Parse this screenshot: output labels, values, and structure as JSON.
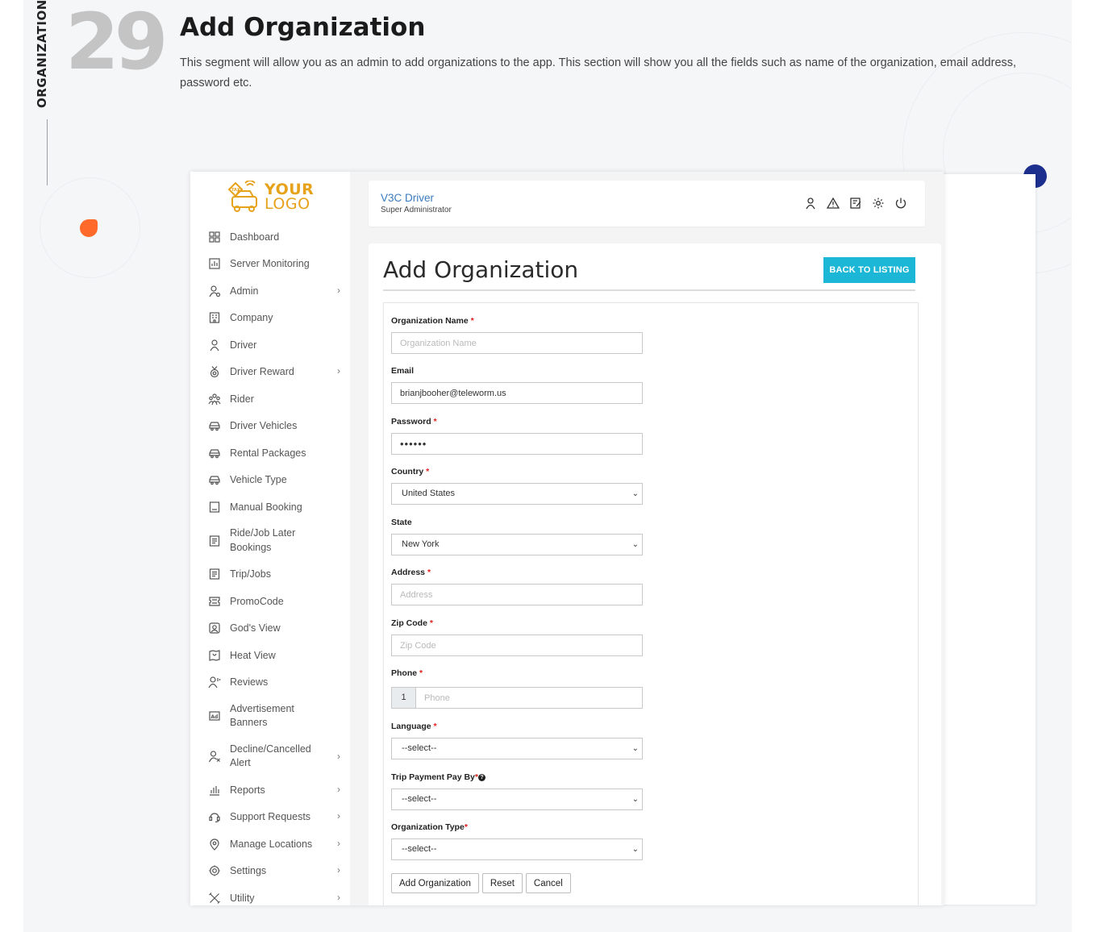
{
  "segment": {
    "label": "ORGANIZATION",
    "number": "29",
    "title": "Add Organization",
    "description": "This segment will allow you as an admin to add organizations to the app. This section will show you all the fields such as name of the organization, email address, password etc."
  },
  "logo": {
    "line1": "YOUR",
    "line2": "LOGO"
  },
  "sidebar": {
    "items": [
      {
        "label": "Dashboard",
        "icon": "dashboard-icon",
        "chevron": false
      },
      {
        "label": "Server Monitoring",
        "icon": "chart-icon",
        "chevron": false
      },
      {
        "label": "Admin",
        "icon": "admin-user-icon",
        "chevron": true
      },
      {
        "label": "Company",
        "icon": "building-icon",
        "chevron": false
      },
      {
        "label": "Driver",
        "icon": "driver-icon",
        "chevron": false
      },
      {
        "label": "Driver Reward",
        "icon": "medal-icon",
        "chevron": true
      },
      {
        "label": "Rider",
        "icon": "rider-group-icon",
        "chevron": false
      },
      {
        "label": "Driver Vehicles",
        "icon": "car-icon",
        "chevron": false
      },
      {
        "label": "Rental Packages",
        "icon": "car-icon",
        "chevron": false
      },
      {
        "label": "Vehicle Type",
        "icon": "car-icon",
        "chevron": false
      },
      {
        "label": "Manual Booking",
        "icon": "booking-icon",
        "chevron": false
      },
      {
        "label": "Ride/Job Later Bookings",
        "icon": "document-icon",
        "chevron": false
      },
      {
        "label": "Trip/Jobs",
        "icon": "document-icon",
        "chevron": false
      },
      {
        "label": "PromoCode",
        "icon": "ticket-icon",
        "chevron": false
      },
      {
        "label": "God's View",
        "icon": "map-view-icon",
        "chevron": false
      },
      {
        "label": "Heat View",
        "icon": "heat-map-icon",
        "chevron": false
      },
      {
        "label": "Reviews",
        "icon": "review-user-icon",
        "chevron": false
      },
      {
        "label": "Advertisement Banners",
        "icon": "ad-icon",
        "chevron": false
      },
      {
        "label": "Decline/Cancelled Alert",
        "icon": "user-cancel-icon",
        "chevron": true
      },
      {
        "label": "Reports",
        "icon": "bar-chart-icon",
        "chevron": true
      },
      {
        "label": "Support Requests",
        "icon": "headset-icon",
        "chevron": true
      },
      {
        "label": "Manage Locations",
        "icon": "location-pin-icon",
        "chevron": true
      },
      {
        "label": "Settings",
        "icon": "gear-icon",
        "chevron": true
      },
      {
        "label": "Utility",
        "icon": "tools-icon",
        "chevron": true
      }
    ]
  },
  "header": {
    "title": "V3C Driver",
    "subtitle": "Super Administrator"
  },
  "main": {
    "title": "Add Organization",
    "back_button": "BACK TO LISTING"
  },
  "form": {
    "org_name": {
      "label": "Organization Name",
      "placeholder": "Organization Name",
      "value": ""
    },
    "email": {
      "label": "Email",
      "value": "brianjbooher@teleworm.us"
    },
    "password": {
      "label": "Password",
      "value": "••••••"
    },
    "country": {
      "label": "Country",
      "value": "United States"
    },
    "state": {
      "label": "State",
      "value": "New York"
    },
    "address": {
      "label": "Address",
      "placeholder": "Address"
    },
    "zip": {
      "label": "Zip Code",
      "placeholder": "Zip Code"
    },
    "phone": {
      "label": "Phone",
      "code": "1",
      "placeholder": "Phone"
    },
    "language": {
      "label": "Language",
      "value": "--select--"
    },
    "trip_payment": {
      "label": "Trip Payment Pay By",
      "value": "--select--"
    },
    "org_type": {
      "label": "Organization Type",
      "value": "--select--"
    },
    "buttons": {
      "add": "Add Organization",
      "reset": "Reset",
      "cancel": "Cancel"
    }
  },
  "colors": {
    "accent": "#1cb7d6",
    "logo": "#e7a21b",
    "required": "#e02020",
    "header_title": "#3a7bbf"
  }
}
